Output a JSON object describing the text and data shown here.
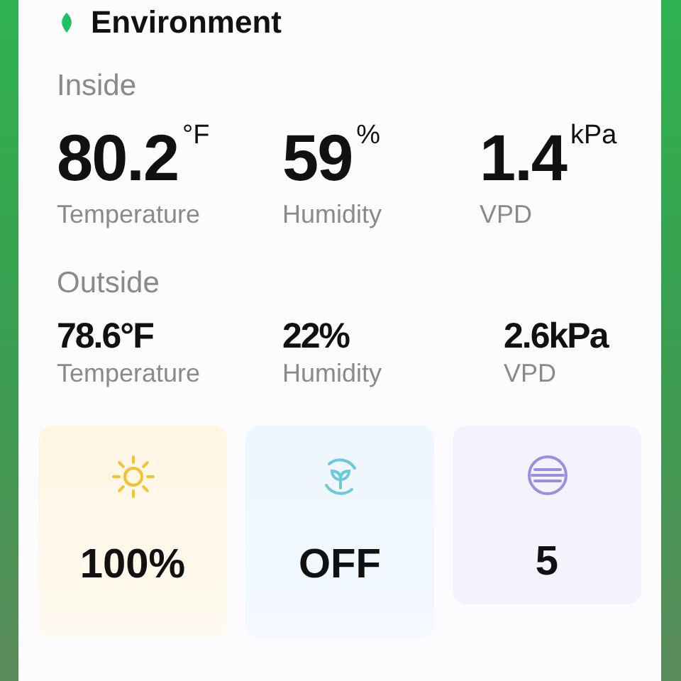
{
  "card": {
    "title": "Environment"
  },
  "sections": [
    {
      "heading": "Inside",
      "kind": "headline",
      "metrics": [
        {
          "value": "80.2",
          "unit": "°F",
          "label": "Temperature"
        },
        {
          "value": "59",
          "unit": "%",
          "label": "Humidity"
        },
        {
          "value": "1.4",
          "unit": "kPa",
          "label": "VPD"
        }
      ]
    },
    {
      "heading": "Outside",
      "kind": "compact",
      "metrics": [
        {
          "value": "78.6°F",
          "label": "Temperature"
        },
        {
          "value": "22%",
          "label": "Humidity"
        },
        {
          "value": "2.6kPa",
          "label": "VPD"
        }
      ]
    }
  ],
  "tiles": [
    {
      "kind": "light",
      "value": "100%",
      "color": "#f2c230"
    },
    {
      "kind": "circulation",
      "value": "OFF",
      "color": "#6cc8dc"
    },
    {
      "kind": "level",
      "value": "5",
      "color": "#9b8fe0"
    }
  ]
}
